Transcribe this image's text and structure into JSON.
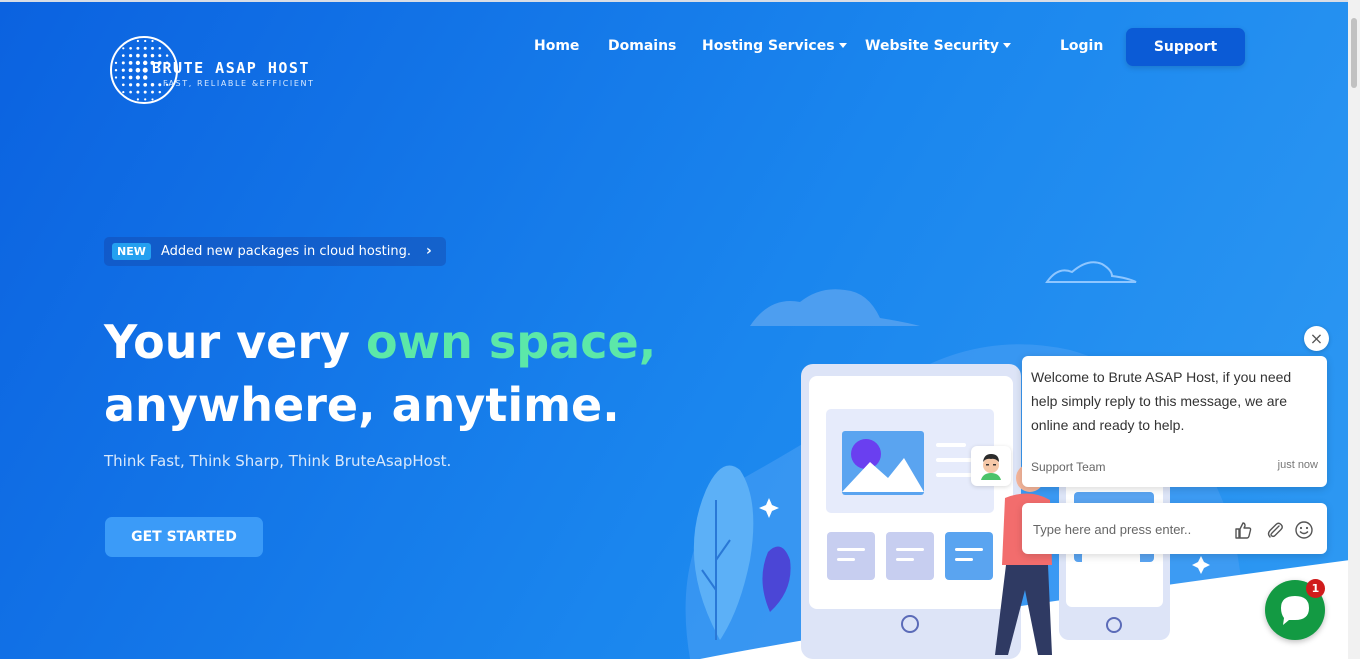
{
  "brand": {
    "name": "BRUTE ASAP HOST",
    "tagline": "FAST, RELIABLE &EFFICIENT"
  },
  "nav": {
    "home": "Home",
    "domains": "Domains",
    "hosting": "Hosting Services",
    "security": "Website Security",
    "login": "Login",
    "support": "Support"
  },
  "announcement": {
    "badge": "NEW",
    "text": "Added new packages in cloud hosting.",
    "arrow": "›"
  },
  "hero": {
    "line1_start": "Your very ",
    "line1_accent": "own space,",
    "line2": "anywhere, anytime.",
    "subtitle": "Think Fast, Think Sharp, Think BruteAsapHost.",
    "cta": "GET STARTED"
  },
  "chat": {
    "close": "×",
    "message": "Welcome to Brute ASAP Host, if you need help simply reply to this message, we are online and ready to help.",
    "from": "Support Team",
    "time": "just now",
    "placeholder": "Type here and press enter..",
    "unread": "1"
  },
  "colors": {
    "accent_green": "#5ce8a8",
    "support_button": "#0b5bd6",
    "cta_button": "#3b9bf8",
    "chat_launcher": "#139a43",
    "badge_red": "#d01c1c"
  }
}
